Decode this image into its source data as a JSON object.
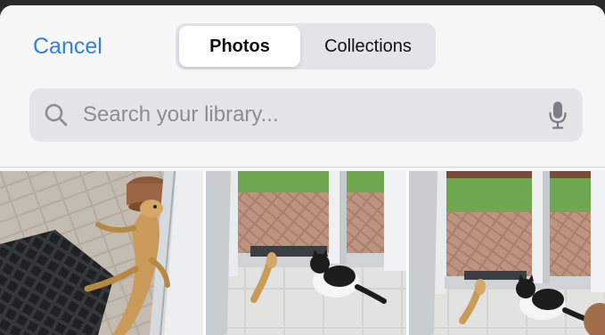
{
  "header": {
    "cancel_label": "Cancel",
    "tabs": [
      {
        "label": "Photos",
        "selected": true
      },
      {
        "label": "Collections",
        "selected": false
      }
    ]
  },
  "search": {
    "placeholder": "Search your library...",
    "value": "",
    "icon": "magnifying-glass-icon",
    "mic_icon": "microphone-icon"
  },
  "photos": [
    {
      "subject": "bearded dragon by sliding door on patio"
    },
    {
      "subject": "bearded dragon and cat at patio door"
    },
    {
      "subject": "bearded dragon and cat at patio door"
    }
  ],
  "colors": {
    "accent": "#2f7fe6",
    "sheet_bg": "#f7f7f8",
    "search_bg": "#e5e5e8",
    "segment_bg": "#e4e4e7"
  }
}
